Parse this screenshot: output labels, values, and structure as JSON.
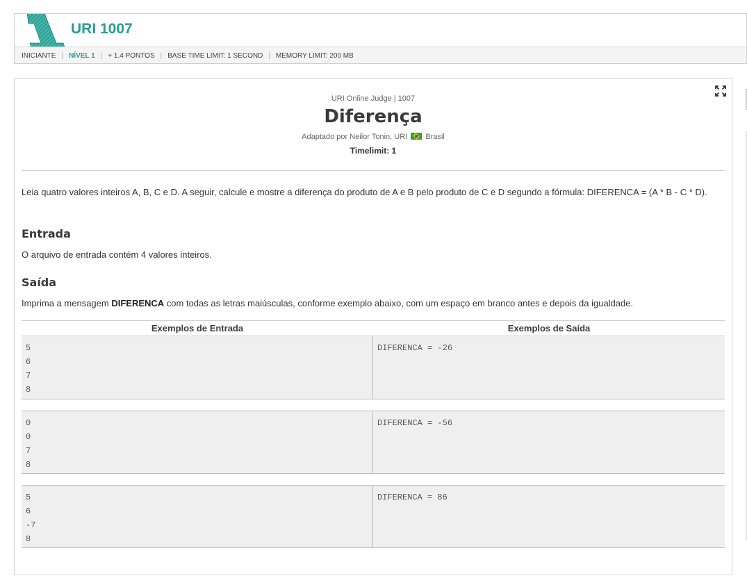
{
  "header": {
    "problem_code": "URI 1007",
    "category": "INICIANTE",
    "level": "NÍVEL 1",
    "points": "+ 1.4 PONTOS",
    "base_time_limit": "BASE TIME LIMIT: 1 SECOND",
    "memory_limit": "MEMORY LIMIT: 200 MB",
    "logo_icon": "uri-logo-icon"
  },
  "problem": {
    "judge_line": "URI Online Judge | 1007",
    "title": "Diferença",
    "author_prefix": "Adaptado por Neilor Tonin, URI",
    "country": "Brasil",
    "timelimit": "Timelimit: 1",
    "description": "Leia quatro valores inteiros A, B, C e D. A seguir, calcule e mostre a diferença do produto de A e B pelo produto de C e D segundo a fórmula: DIFERENCA = (A * B - C * D).",
    "input_title": "Entrada",
    "input_text": "O arquivo de entrada contém 4 valores inteiros.",
    "output_title": "Saída",
    "output_text_before": "Imprima a mensagem ",
    "output_text_bold": "DIFERENCA",
    "output_text_after": " com todas as letras maiúsculas, conforme exemplo abaixo, com um espaço em branco antes e depois da igualdade.",
    "expand_icon": "expand-icon"
  },
  "examples": {
    "input_header": "Exemplos de Entrada",
    "output_header": "Exemplos de Saída",
    "rows": [
      {
        "input": "5\n6\n7\n8",
        "output": "DIFERENCA = -26"
      },
      {
        "input": "0\n0\n7\n8",
        "output": "DIFERENCA = -56"
      },
      {
        "input": "5\n6\n-7\n8",
        "output": "DIFERENCA = 86"
      }
    ]
  },
  "colors": {
    "accent": "#2a9c92",
    "example_bg": "#efefef"
  }
}
